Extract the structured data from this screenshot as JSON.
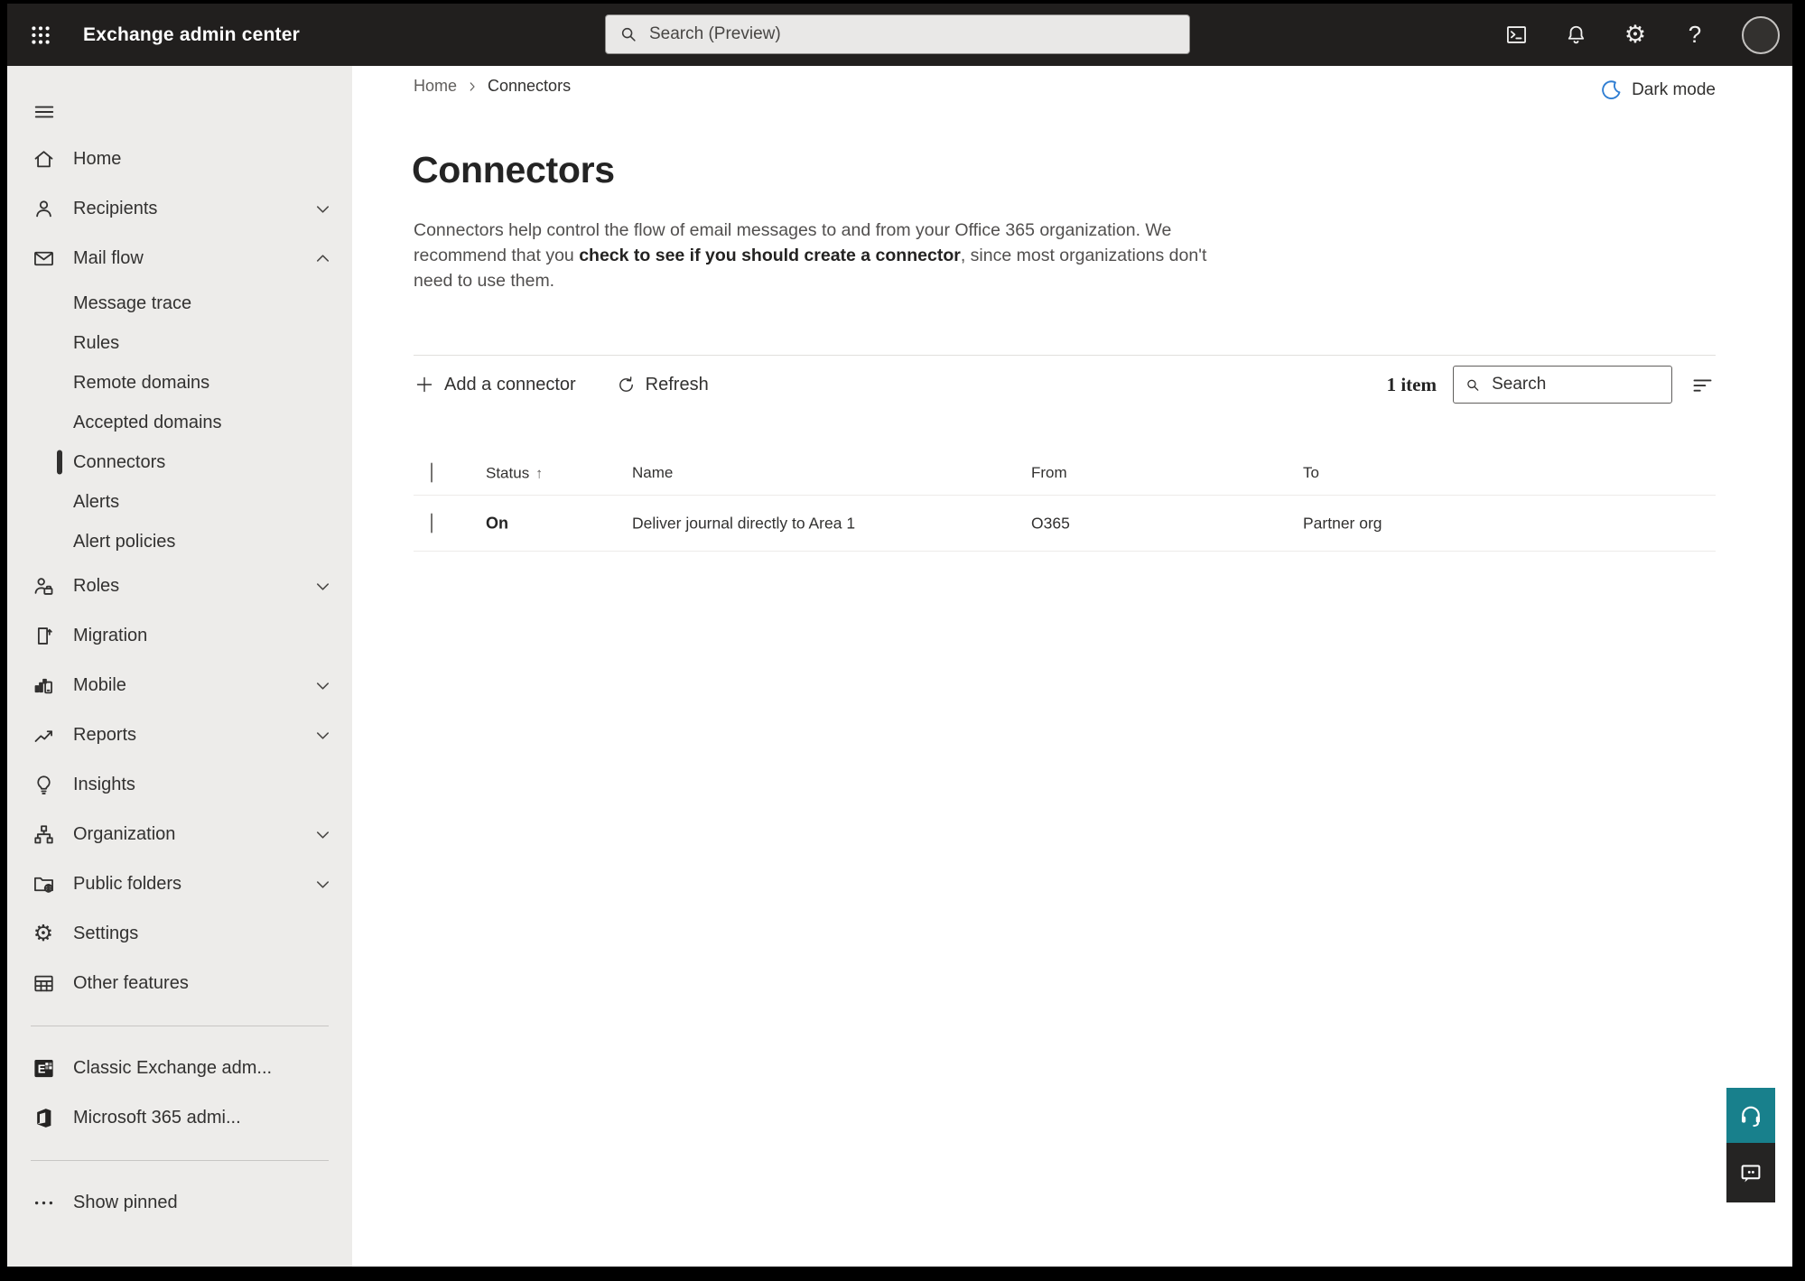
{
  "topbar": {
    "app_title": "Exchange admin center",
    "search_placeholder": "Search (Preview)"
  },
  "sidebar": {
    "items": [
      {
        "id": "home",
        "label": "Home",
        "icon": "home-icon",
        "type": "main"
      },
      {
        "id": "recipients",
        "label": "Recipients",
        "icon": "person-icon",
        "type": "main",
        "chevron": "down"
      },
      {
        "id": "mail-flow",
        "label": "Mail flow",
        "icon": "mail-icon",
        "type": "main",
        "chevron": "up"
      },
      {
        "id": "message-trace",
        "label": "Message trace",
        "type": "sub"
      },
      {
        "id": "rules",
        "label": "Rules",
        "type": "sub"
      },
      {
        "id": "remote-domains",
        "label": "Remote domains",
        "type": "sub"
      },
      {
        "id": "accepted-domains",
        "label": "Accepted domains",
        "type": "sub"
      },
      {
        "id": "connectors",
        "label": "Connectors",
        "type": "sub",
        "selected": true
      },
      {
        "id": "alerts",
        "label": "Alerts",
        "type": "sub"
      },
      {
        "id": "alert-policies",
        "label": "Alert policies",
        "type": "sub"
      },
      {
        "id": "roles",
        "label": "Roles",
        "icon": "roles-icon",
        "type": "main",
        "chevron": "down"
      },
      {
        "id": "migration",
        "label": "Migration",
        "icon": "migration-icon",
        "type": "main"
      },
      {
        "id": "mobile",
        "label": "Mobile",
        "icon": "mobile-icon",
        "type": "main",
        "chevron": "down"
      },
      {
        "id": "reports",
        "label": "Reports",
        "icon": "reports-icon",
        "type": "main",
        "chevron": "down"
      },
      {
        "id": "insights",
        "label": "Insights",
        "icon": "insights-icon",
        "type": "main"
      },
      {
        "id": "organization",
        "label": "Organization",
        "icon": "organization-icon",
        "type": "main",
        "chevron": "down"
      },
      {
        "id": "public-folders",
        "label": "Public folders",
        "icon": "public-folders-icon",
        "type": "main",
        "chevron": "down"
      },
      {
        "id": "settings",
        "label": "Settings",
        "icon": "settings-icon",
        "type": "main"
      },
      {
        "id": "other-features",
        "label": "Other features",
        "icon": "other-features-icon",
        "type": "main"
      },
      {
        "type": "divider"
      },
      {
        "id": "classic-exchange",
        "label": "Classic Exchange adm...",
        "icon": "classic-exchange-icon",
        "type": "main"
      },
      {
        "id": "microsoft-365",
        "label": "Microsoft 365 admi...",
        "icon": "microsoft-365-icon",
        "type": "main"
      },
      {
        "type": "divider"
      },
      {
        "id": "show-pinned",
        "label": "Show pinned",
        "icon": "ellipsis-icon",
        "type": "main"
      }
    ]
  },
  "breadcrumb": {
    "items": [
      "Home",
      "Connectors"
    ]
  },
  "dark_mode_label": "Dark mode",
  "page": {
    "title": "Connectors",
    "description_before": "Connectors help control the flow of email messages to and from your Office 365 organization. We recommend that you ",
    "description_link": "check to see if you should create a connector",
    "description_after": ", since most organizations don't need to use them."
  },
  "toolbar": {
    "add_label": "Add a connector",
    "refresh_label": "Refresh",
    "count_label": "1 item",
    "search_placeholder": "Search"
  },
  "table": {
    "headers": [
      "Status",
      "Name",
      "From",
      "To"
    ],
    "sorted_by": "Status",
    "sort_direction": "asc",
    "rows": [
      {
        "status": "On",
        "name": "Deliver journal directly to Area 1",
        "from": "O365",
        "to": "Partner org"
      }
    ]
  },
  "colors": {
    "topbar_bg": "#211f1e",
    "sidebar_bg": "#edecea",
    "accent_teal": "#18808c",
    "moon_blue": "#2e7dd2",
    "selection_bar": "#31302f"
  }
}
